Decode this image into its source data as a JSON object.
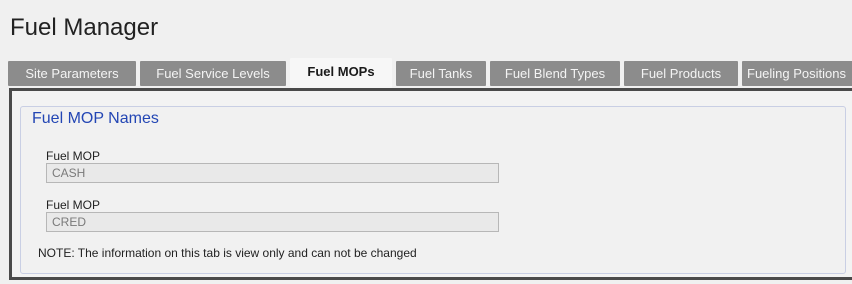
{
  "page": {
    "title": "Fuel Manager"
  },
  "tabs": [
    {
      "label": "Site Parameters",
      "active": false
    },
    {
      "label": "Fuel Service Levels",
      "active": false
    },
    {
      "label": "Fuel MOPs",
      "active": true
    },
    {
      "label": "Fuel Tanks",
      "active": false
    },
    {
      "label": "Fuel Blend Types",
      "active": false
    },
    {
      "label": "Fuel Products",
      "active": false
    },
    {
      "label": "Fueling Positions",
      "active": false
    }
  ],
  "section": {
    "legend": "Fuel MOP Names",
    "fields": [
      {
        "label": "Fuel MOP",
        "value": "CASH"
      },
      {
        "label": "Fuel MOP",
        "value": "CRED"
      }
    ],
    "note": "NOTE: The information on this tab is view only and can not be changed"
  },
  "colors": {
    "tab_inactive_bg": "#8c8c8c",
    "tab_active_bg": "#f7f7f7",
    "legend_text": "#2346b4",
    "panel_border": "#4a4a4a"
  }
}
